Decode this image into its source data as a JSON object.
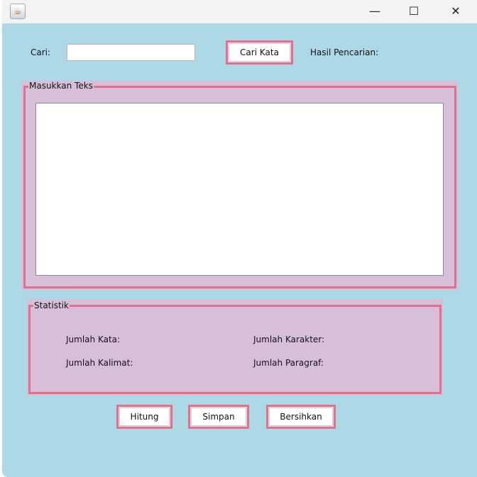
{
  "window": {
    "icon": "java-coffee-icon",
    "controls": [
      "minimize-icon",
      "maximize-icon",
      "close-icon"
    ]
  },
  "search": {
    "label": "Cari:",
    "value": "",
    "button": "Cari Kata",
    "result_label": "Hasil Pencarian:"
  },
  "text_panel": {
    "title": "Masukkan Teks",
    "value": ""
  },
  "stats": {
    "title": "Statistik",
    "kata": "Jumlah Kata:",
    "karakter": "Jumlah Karakter:",
    "kalimat": "Jumlah Kalimat:",
    "paragraf": "Jumlah Paragraf:"
  },
  "buttons": {
    "hitung": "Hitung",
    "simpan": "Simpan",
    "bersihkan": "Bersihkan"
  },
  "colors": {
    "background": "#add8e6",
    "panel": "#d8bfd8",
    "border": "#e07090"
  }
}
